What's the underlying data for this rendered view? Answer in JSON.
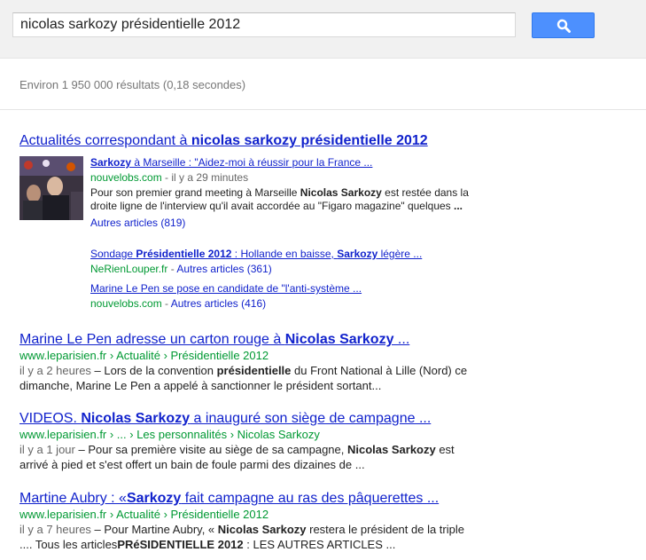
{
  "search": {
    "query": "nicolas sarkozy présidentielle 2012",
    "button_icon": "search-icon"
  },
  "stats": "Environ 1 950 000 résultats (0,18 secondes)",
  "news": {
    "heading_prefix": "Actualités correspondant à ",
    "heading_bold": "nicolas sarkozy présidentielle 2012",
    "thumbnail": "photo-thumbnail",
    "main": {
      "title_part1": "Sarkozy",
      "title_part2": " à Marseille : \"Aidez-moi à réussir pour la France ...",
      "source": "nouvelobs.com",
      "time": " - il y a 29 minutes",
      "snippet_a": "Pour son premier grand meeting à Marseille ",
      "snippet_b": "Nicolas Sarkozy",
      "snippet_c": " est restée dans la droite ligne de l'interview qu'il avait accordée au \"Figaro magazine\" quelques ",
      "snippet_d": "...",
      "more": "Autres articles (819)"
    },
    "item2": {
      "t1": "Sondage ",
      "t2": "Présidentielle 2012",
      "t3": " : Hollande en baisse, ",
      "t4": "Sarkozy",
      "t5": " légère ...",
      "source": "NeRienLouper.fr",
      "sep": " - ",
      "more": "Autres articles (361)"
    },
    "item3": {
      "title": "Marine Le Pen se pose en candidate de \"l'anti-système ...",
      "source": "nouvelobs.com",
      "sep": " - ",
      "more": "Autres articles (416)"
    }
  },
  "results": [
    {
      "t1": "Marine Le Pen adresse un carton rouge à ",
      "t2": "Nicolas Sarkozy",
      "t3": " ...",
      "url": "www.leparisien.fr › Actualité › Présidentielle 2012",
      "time": "il y a 2 heures",
      "s1": " – Lors de la convention ",
      "s2": "présidentielle",
      "s3": " du Front National à Lille (Nord) ce dimanche, Marine Le Pen a appelé à sanctionner le président sortant..."
    },
    {
      "t1": "VIDEOS. ",
      "t2": "Nicolas Sarkozy",
      "t3": " a inauguré son siège de campagne ...",
      "url": "www.leparisien.fr › ... › Les personnalités › Nicolas Sarkozy",
      "time": "il y a 1 jour",
      "s1": " – Pour sa première visite au siège de sa campagne, ",
      "s2": "Nicolas Sarkozy",
      "s3": " est arrivé à pied et s'est offert un bain de foule parmi des dizaines de ..."
    },
    {
      "t1": "Martine Aubry : «",
      "t2": "Sarkozy",
      "t3": " fait campagne au ras des pâquerettes ...",
      "url": "www.leparisien.fr › Actualité › Présidentielle 2012",
      "time": "il y a 7 heures",
      "s1": " – Pour Martine Aubry, « ",
      "s2": "Nicolas Sarkozy",
      "s3": " restera le président de la triple .... Tous les articles",
      "s4": "PRéSIDENTIELLE 2012",
      "s5": " : LES AUTRES ARTICLES ..."
    }
  ]
}
